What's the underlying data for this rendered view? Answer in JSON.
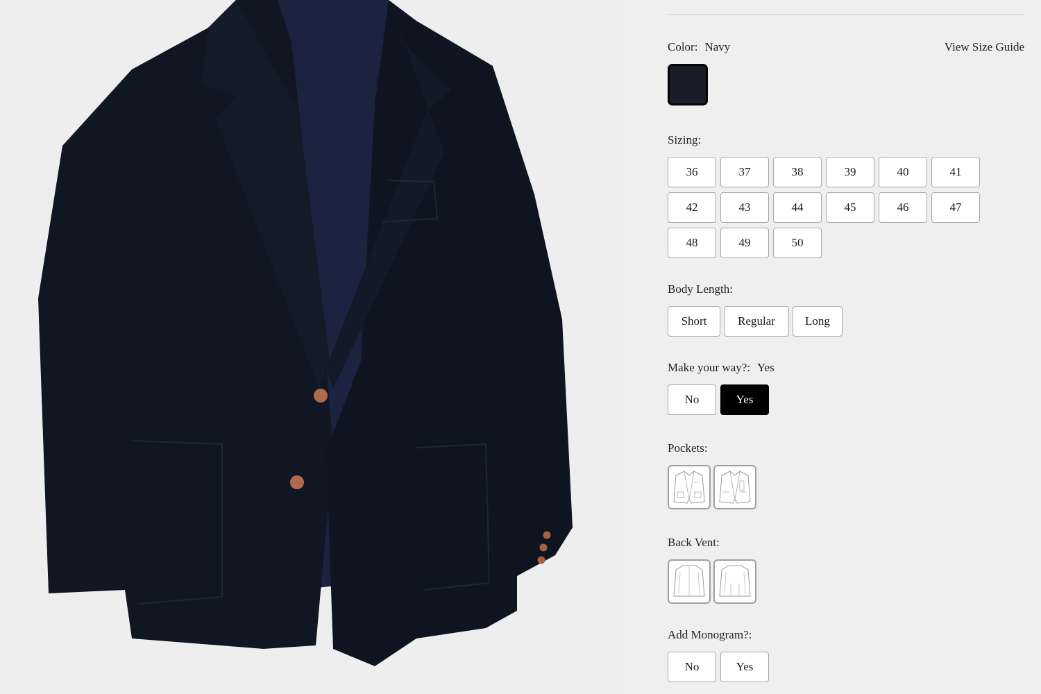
{
  "product_image": {
    "alt": "Navy jacket",
    "color": "#111827",
    "lining_color": "#1b2340",
    "button_color": "#b06a4b"
  },
  "options": {
    "divider": true,
    "color": {
      "label": "Color:",
      "value": "Navy",
      "swatch_color": "#1a1d28"
    },
    "size_guide_link": "View Size Guide",
    "sizing": {
      "label": "Sizing:",
      "sizes": [
        "36",
        "37",
        "38",
        "39",
        "40",
        "41",
        "42",
        "43",
        "44",
        "45",
        "46",
        "47",
        "48",
        "49",
        "50"
      ]
    },
    "body_length": {
      "label": "Body Length:",
      "options": [
        "Short",
        "Regular",
        "Long"
      ]
    },
    "make_your_way": {
      "label": "Make your way?:",
      "value": "Yes",
      "options": [
        "No",
        "Yes"
      ],
      "selected": "Yes"
    },
    "pockets": {
      "label": "Pockets:",
      "options": [
        "patch-pockets-jacket-icon",
        "flap-pockets-jacket-icon"
      ]
    },
    "back_vent": {
      "label": "Back Vent:",
      "options": [
        "center-vent-jacket-back-icon",
        "side-vents-jacket-back-icon"
      ]
    },
    "monogram": {
      "label": "Add Monogram?:",
      "options": [
        "No",
        "Yes"
      ]
    }
  }
}
